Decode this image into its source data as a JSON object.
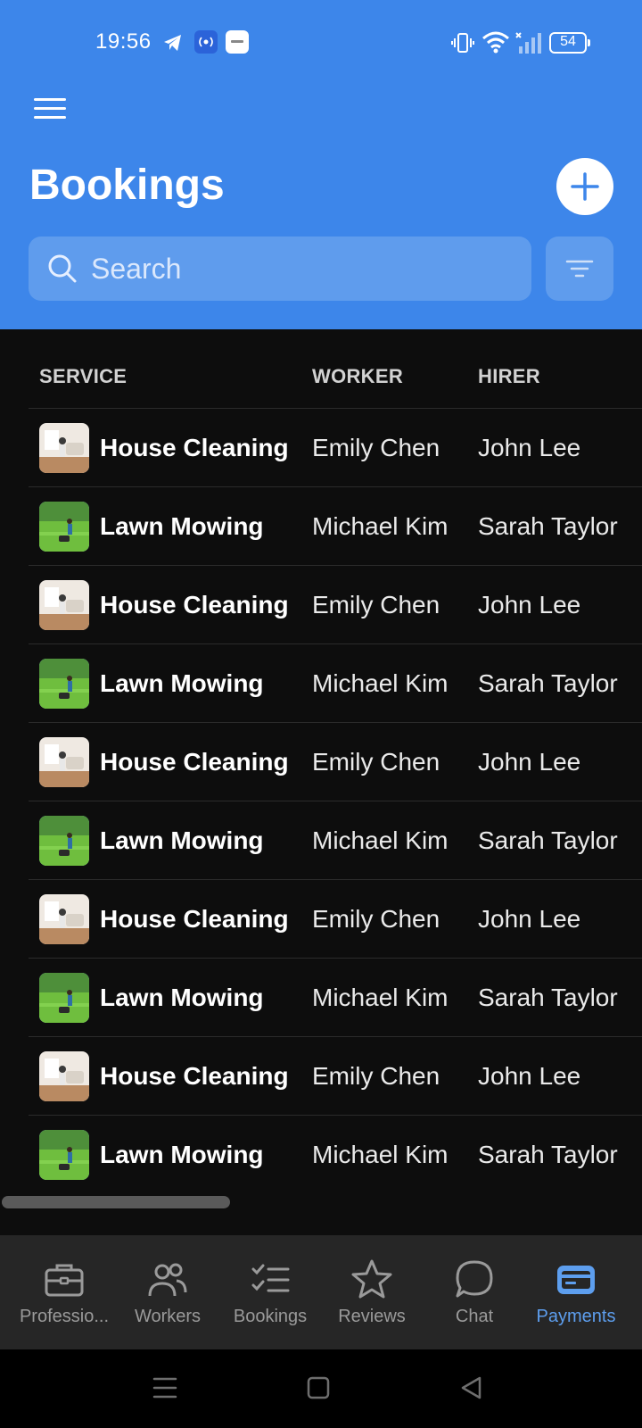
{
  "status_bar": {
    "time": "19:56",
    "battery": "54",
    "icons": [
      "telegram-icon",
      "broadcast-icon",
      "app-notification-icon",
      "vibrate-icon",
      "wifi-icon",
      "signal-icon",
      "battery-icon"
    ]
  },
  "header": {
    "title": "Bookings",
    "menu_icon": "hamburger-menu-icon",
    "add_icon": "plus-icon"
  },
  "search": {
    "placeholder": "Search",
    "value": "",
    "filter_icon": "filter-icon"
  },
  "table": {
    "columns": [
      "SERVICE",
      "WORKER",
      "HIRER"
    ],
    "rows": [
      {
        "service": "House Cleaning",
        "worker": "Emily Chen",
        "hirer": "John Lee",
        "thumb": "house-cleaning"
      },
      {
        "service": "Lawn Mowing",
        "worker": "Michael Kim",
        "hirer": "Sarah Taylor",
        "thumb": "lawn-mowing"
      },
      {
        "service": "House Cleaning",
        "worker": "Emily Chen",
        "hirer": "John Lee",
        "thumb": "house-cleaning"
      },
      {
        "service": "Lawn Mowing",
        "worker": "Michael Kim",
        "hirer": "Sarah Taylor",
        "thumb": "lawn-mowing"
      },
      {
        "service": "House Cleaning",
        "worker": "Emily Chen",
        "hirer": "John Lee",
        "thumb": "house-cleaning"
      },
      {
        "service": "Lawn Mowing",
        "worker": "Michael Kim",
        "hirer": "Sarah Taylor",
        "thumb": "lawn-mowing"
      },
      {
        "service": "House Cleaning",
        "worker": "Emily Chen",
        "hirer": "John Lee",
        "thumb": "house-cleaning"
      },
      {
        "service": "Lawn Mowing",
        "worker": "Michael Kim",
        "hirer": "Sarah Taylor",
        "thumb": "lawn-mowing"
      },
      {
        "service": "House Cleaning",
        "worker": "Emily Chen",
        "hirer": "John Lee",
        "thumb": "house-cleaning"
      },
      {
        "service": "Lawn Mowing",
        "worker": "Michael Kim",
        "hirer": "Sarah Taylor",
        "thumb": "lawn-mowing"
      }
    ]
  },
  "bottom_nav": {
    "items": [
      {
        "label": "Professio...",
        "icon": "briefcase-icon",
        "active": false
      },
      {
        "label": "Workers",
        "icon": "users-icon",
        "active": false
      },
      {
        "label": "Bookings",
        "icon": "checklist-icon",
        "active": false
      },
      {
        "label": "Reviews",
        "icon": "star-icon",
        "active": false
      },
      {
        "label": "Chat",
        "icon": "chat-bubble-icon",
        "active": false
      },
      {
        "label": "Payments",
        "icon": "credit-card-icon",
        "active": true
      }
    ]
  },
  "system_nav": {
    "icons": [
      "recent-apps-icon",
      "home-icon",
      "back-icon"
    ]
  },
  "colors": {
    "header": "#3d86ea",
    "background": "#0d0d0d",
    "nav_background": "#262626",
    "active": "#5d9eee"
  }
}
